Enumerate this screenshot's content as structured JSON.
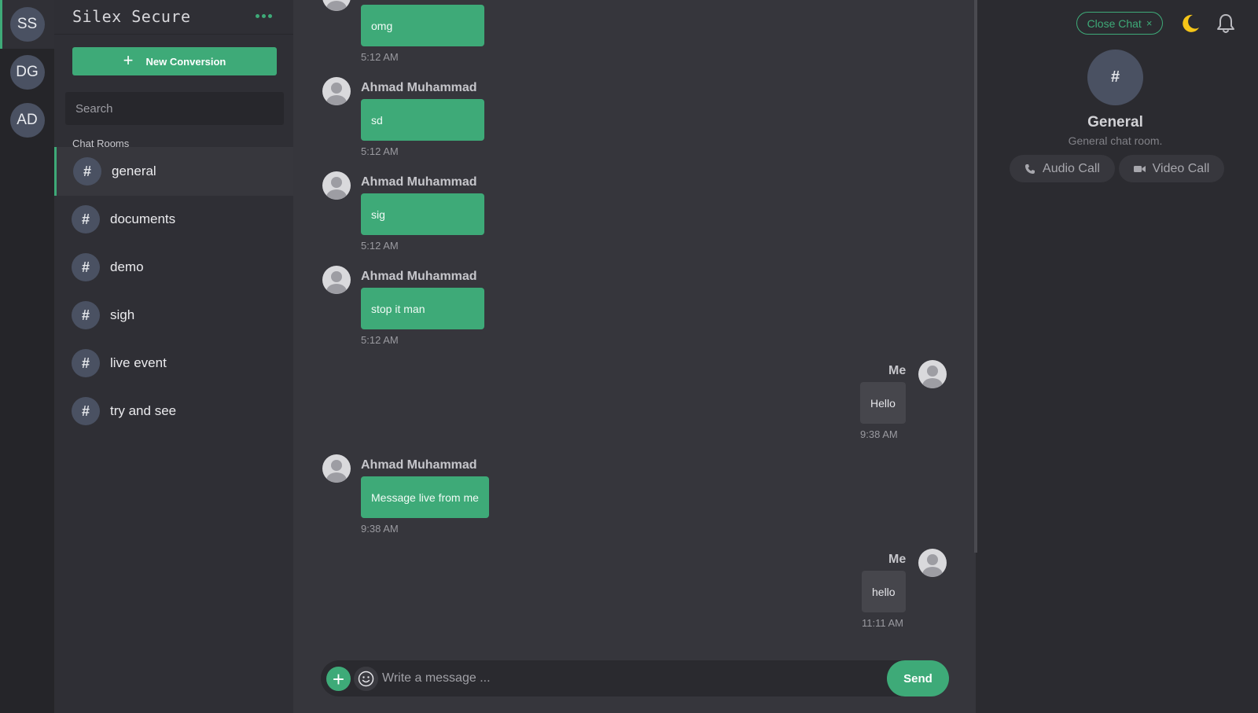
{
  "workspaces": [
    {
      "initials": "SS",
      "active": true
    },
    {
      "initials": "DG",
      "active": false
    },
    {
      "initials": "AD",
      "active": false
    }
  ],
  "sidebar": {
    "brand": "Silex Secure",
    "new_button_label": "New Conversion",
    "search_placeholder": "Search",
    "rooms_label": "Chat Rooms",
    "rooms": [
      {
        "name": "general",
        "active": true
      },
      {
        "name": "documents",
        "active": false
      },
      {
        "name": "demo",
        "active": false
      },
      {
        "name": "sigh",
        "active": false
      },
      {
        "name": "live event",
        "active": false
      },
      {
        "name": "try and see",
        "active": false
      }
    ],
    "room_icon": "#"
  },
  "messages": [
    {
      "sender": "",
      "text": "omg",
      "time": "5:12 AM",
      "direction": "in"
    },
    {
      "sender": "Ahmad Muhammad",
      "text": "sd",
      "time": "5:12 AM",
      "direction": "in"
    },
    {
      "sender": "Ahmad Muhammad",
      "text": "sig",
      "time": "5:12 AM",
      "direction": "in"
    },
    {
      "sender": "Ahmad Muhammad",
      "text": "stop it man",
      "time": "5:12 AM",
      "direction": "in"
    },
    {
      "sender": "Me",
      "text": "Hello",
      "time": "9:38 AM",
      "direction": "out"
    },
    {
      "sender": "Ahmad Muhammad",
      "text": "Message live from me",
      "time": "9:38 AM",
      "direction": "in"
    },
    {
      "sender": "Me",
      "text": "hello",
      "time": "11:11 AM",
      "direction": "out"
    }
  ],
  "composer": {
    "placeholder": "Write a message ...",
    "send_label": "Send",
    "attach_icon": "plus-icon",
    "emoji_icon": "smiley-icon"
  },
  "info_panel": {
    "close_label": "Close Chat",
    "close_icon": "×",
    "room_icon": "#",
    "room_name": "General",
    "room_description": "General chat room.",
    "audio_call_label": "Audio Call",
    "video_call_label": "Video Call",
    "theme_icon": "moon-icon",
    "notifications_icon": "bell-icon"
  },
  "colors": {
    "accent": "#3eaa78",
    "background": "#2b2b30",
    "chat_background": "#36363c",
    "avatar": "#4a5162",
    "moon": "#f5c518"
  }
}
